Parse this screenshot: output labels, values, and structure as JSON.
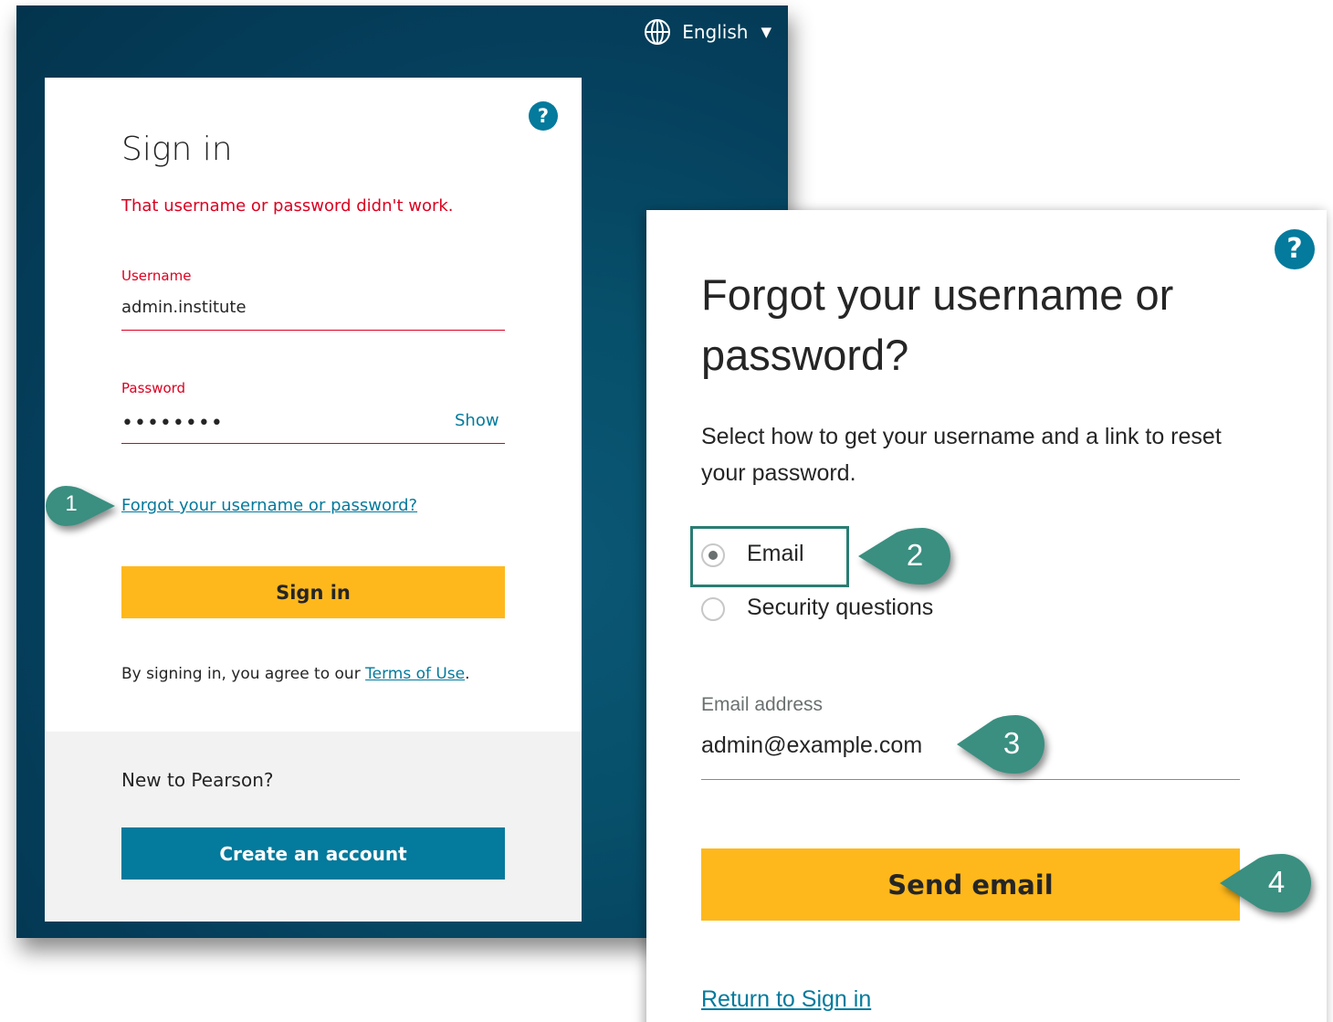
{
  "language": {
    "label": "English",
    "icon": "globe-icon",
    "caret_icon": "caret-down-icon"
  },
  "signin": {
    "title": "Sign in",
    "error": "That username or password didn't work.",
    "username_label": "Username",
    "username_value": "admin.institute",
    "password_label": "Password",
    "password_value": "••••••••",
    "show_label": "Show",
    "forgot_link": "Forgot your username or password?",
    "signin_button": "Sign in",
    "terms_prefix": "By signing in, you agree to our ",
    "terms_link": "Terms of Use",
    "terms_suffix": ".",
    "new_to": "New to Pearson?",
    "create_button": "Create an account",
    "help_icon": "?"
  },
  "forgot": {
    "title": "Forgot your username or password?",
    "description": "Select how to get your username and a link to reset your password.",
    "options": [
      {
        "label": "Email",
        "checked": true
      },
      {
        "label": "Security questions",
        "checked": false
      }
    ],
    "email_label": "Email address",
    "email_value": "admin@example.com",
    "send_button": "Send email",
    "return_link": "Return to Sign in",
    "help_icon": "?"
  },
  "callouts": [
    "1",
    "2",
    "3",
    "4"
  ],
  "colors": {
    "accent_teal": "#047a9c",
    "button_yellow": "#ffb81c",
    "error_red": "#db0020",
    "callout_green": "#3a8f80",
    "highlight_border": "#2a7d73",
    "background_dark": "#053f5c"
  }
}
